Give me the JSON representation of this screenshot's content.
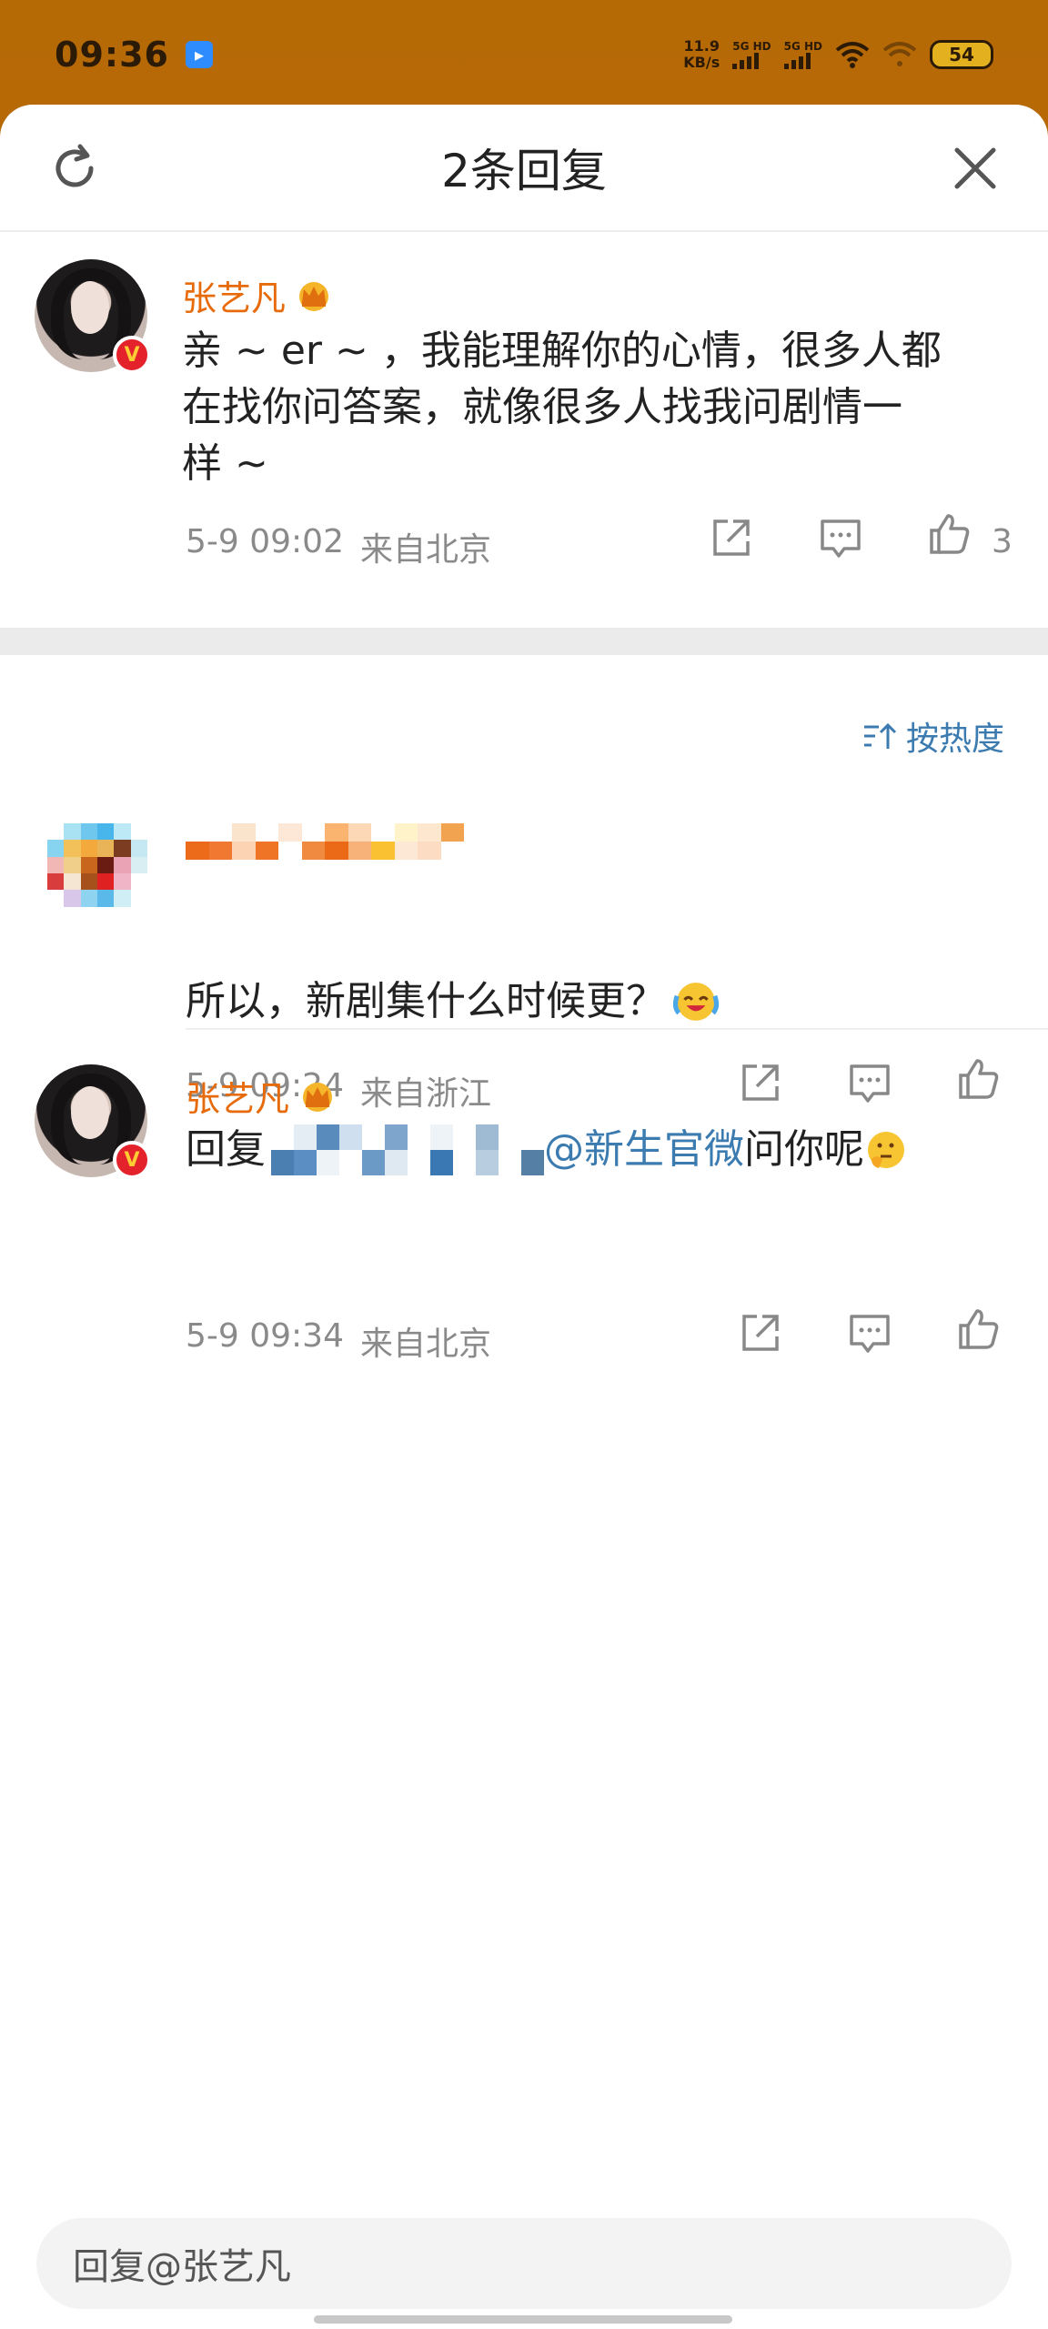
{
  "status_bar": {
    "time": "09:36",
    "net_speed_value": "11.9",
    "net_speed_unit": "KB/s",
    "signal1_label": "5G HD",
    "signal2_label": "5G HD",
    "battery": "54"
  },
  "header": {
    "title": "2条回复",
    "refresh_icon": "refresh-icon",
    "close_icon": "close-icon"
  },
  "top_comment": {
    "author": "张艺凡",
    "text_line1": "亲 ~ er ~ ，我能理解你的心情，很多人都",
    "text_line2": "在找你问答案，就像很多人找我问剧情一",
    "text_line3": "样 ~",
    "time": "5-9 09:02",
    "location": "来自北京",
    "like_count": "3"
  },
  "sort": {
    "label": "按热度"
  },
  "replies": [
    {
      "author_hidden": true,
      "text": "所以，新剧集什么时候更？",
      "time": "5-9 09:24",
      "location": "来自浙江"
    },
    {
      "author": "张艺凡",
      "reply_prefix": "回复",
      "mention": "@新生官微",
      "text_suffix": " 问你呢",
      "time": "5-9 09:34",
      "location": "来自北京"
    }
  ],
  "reply_input": {
    "placeholder": "回复@张艺凡"
  },
  "colors": {
    "accent_name": "#e76b0a",
    "link_blue": "#3b7bb0",
    "meta_gray": "#8a8a8a"
  }
}
